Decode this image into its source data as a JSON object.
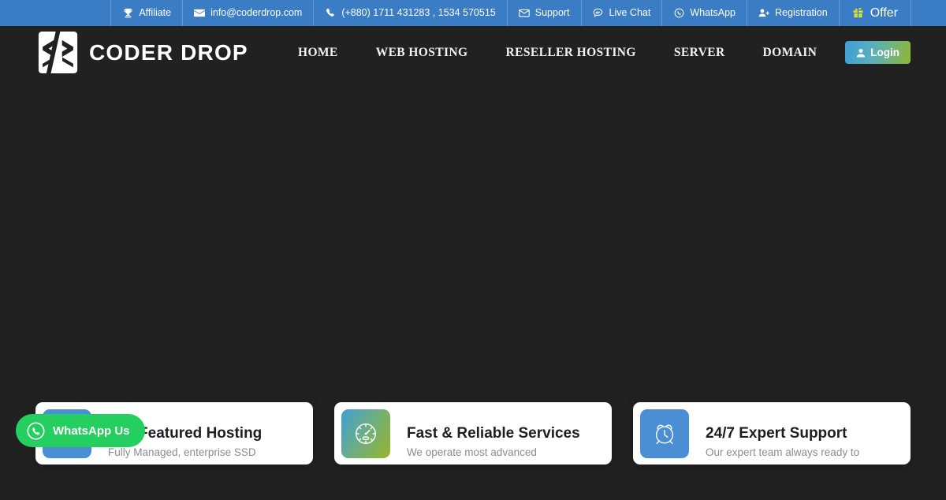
{
  "topbar": {
    "background_color": "#3b7dc4",
    "items": [
      {
        "label": "Affiliate",
        "icon": "trophy-icon"
      },
      {
        "label": "info@coderdrop.com",
        "icon": "envelope-icon"
      },
      {
        "label": "(+880) 1711 431283 , 1534 570515",
        "icon": "phone-icon"
      },
      {
        "label": "Support",
        "icon": "mail-open-icon"
      },
      {
        "label": "Live Chat",
        "icon": "chat-bubble-icon"
      },
      {
        "label": "WhatsApp",
        "icon": "whatsapp-icon"
      },
      {
        "label": "Registration",
        "icon": "user-plus-icon"
      },
      {
        "label": "Offer",
        "icon": "gift-icon"
      }
    ]
  },
  "header": {
    "background_color": "#212121",
    "brand": {
      "name": "CODER DROP",
      "logo_icon": "code-brackets-logo"
    },
    "nav": [
      {
        "label": "HOME"
      },
      {
        "label": "WEB HOSTING"
      },
      {
        "label": "RESELLER HOSTING"
      },
      {
        "label": "SERVER"
      },
      {
        "label": "DOMAIN"
      }
    ],
    "login": {
      "label": "Login",
      "icon": "user-icon",
      "gradient_from": "#3f9fd8",
      "gradient_to": "#8fb733"
    }
  },
  "hero": {
    "background_color": "#212121"
  },
  "cards": [
    {
      "title": "Full Featured Hosting",
      "desc": "Fully Managed, enterprise SSD",
      "icon": "server-icon",
      "icon_style": "grad-blue"
    },
    {
      "title": "Fast & Reliable Services",
      "desc": "We operate most advanced",
      "icon": "speedometer-icon",
      "icon_style": "grad-bluegreen"
    },
    {
      "title": "24/7 Expert Support",
      "desc": "Our expert team always ready to",
      "icon": "alarm-clock-icon",
      "icon_style": "grad-blue"
    }
  ],
  "whatsapp_float": {
    "label": "WhatsApp Us",
    "icon": "whatsapp-icon",
    "color": "#25cf5f"
  }
}
